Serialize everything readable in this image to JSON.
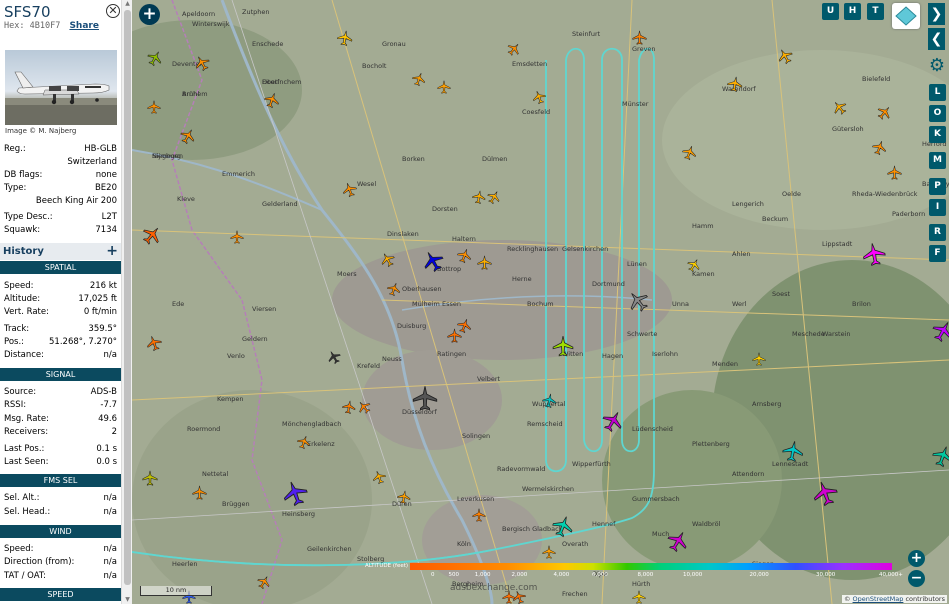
{
  "sidebar": {
    "callsign": "SFS70",
    "hex_label": "Hex:",
    "hex": "4B10F7",
    "share": "Share",
    "photo_credit": "Image © M. Najberg",
    "reg_label": "Reg.:",
    "reg": "HB-GLB",
    "country": "Switzerland",
    "dbflags_label": "DB flags:",
    "dbflags": "none",
    "type_label": "Type:",
    "type": "BE20",
    "type_name": "Beech King Air 200",
    "typedesc_label": "Type Desc.:",
    "typedesc": "L2T",
    "squawk_label": "Squawk:",
    "squawk": "7134",
    "history": "History",
    "spatial": "SPATIAL",
    "speed_label": "Speed:",
    "speed": "216 kt",
    "altitude_label": "Altitude:",
    "altitude": "17,025 ft",
    "vrate_label": "Vert. Rate:",
    "vrate": "0 ft/min",
    "track_label": "Track:",
    "track": "359.5°",
    "pos_label": "Pos.:",
    "pos": "51.268°, 7.270°",
    "distance_label": "Distance:",
    "distance": "n/a",
    "signal": "SIGNAL",
    "source_label": "Source:",
    "source": "ADS-B",
    "rssi_label": "RSSI:",
    "rssi": "-7.7",
    "msgrate_label": "Msg. Rate:",
    "msgrate": "49.6",
    "receivers_label": "Receivers:",
    "receivers": "2",
    "lastpos_label": "Last Pos.:",
    "lastpos": "0.1 s",
    "lastseen_label": "Last Seen:",
    "lastseen": "0.0 s",
    "fmssel": "FMS SEL",
    "selalt_label": "Sel. Alt.:",
    "selalt": "n/a",
    "selhead_label": "Sel. Head.:",
    "selhead": "n/a",
    "wind": "WIND",
    "wspeed_label": "Speed:",
    "wspeed": "n/a",
    "wdir_label": "Direction (from):",
    "wdir": "n/a",
    "tat_label": "TAT / OAT:",
    "tat": "n/a",
    "speed_section": "SPEED"
  },
  "map": {
    "buttons_top": [
      "U",
      "H",
      "T"
    ],
    "buttons_side": [
      "L",
      "O",
      "K",
      "M",
      "P",
      "I",
      "R",
      "F"
    ],
    "legend_title": "ALTITUDE (feet)",
    "legend_ticks": [
      "0",
      "500",
      "1,000",
      "2,000",
      "4,000",
      "6,000",
      "8,000",
      "10,000",
      "20,000",
      "30,000",
      "40,000+"
    ],
    "scale": "10 nm",
    "attribution_prefix": "©",
    "attribution_link": "OpenStreetMap",
    "attribution_suffix": "contributors",
    "watermark": "adsbexchange.com",
    "labels": [
      "Arnhem",
      "Nijmegen",
      "Doetinchem",
      "Bocholt",
      "Borken",
      "Coesfeld",
      "Dülmen",
      "Haltern",
      "Münster",
      "Warendorf",
      "Gütersloh",
      "Bielefeld",
      "Hamm",
      "Soest",
      "Unna",
      "Dortmund",
      "Bochum",
      "Herne",
      "Gelsenkirchen",
      "Recklinghausen",
      "Essen",
      "Bottrop",
      "Oberhausen",
      "Duisburg",
      "Mülheim",
      "Krefeld",
      "Venlo",
      "Düsseldorf",
      "Mönchengladbach",
      "Wuppertal",
      "Solingen",
      "Remscheid",
      "Hagen",
      "Iserlohn",
      "Arnsberg",
      "Lüdenscheid",
      "Leverkusen",
      "Köln",
      "Bergisch Gladbach",
      "Gummersbach",
      "Siegen",
      "Heerlen",
      "Roermond",
      "Moers",
      "Kleve",
      "Emmerich",
      "Wesel",
      "Dorsten",
      "Lippstadt",
      "Paderborn",
      "Olpe",
      "Meschede",
      "Erkelenz",
      "Dinslaken",
      "Lünen",
      "Schwerte",
      "Witten",
      "Velbert",
      "Ratingen",
      "Neuss",
      "Viersen",
      "Ahlen",
      "Beckum",
      "Kamen",
      "Werl",
      "Menden",
      "Plettenberg",
      "Wipperfürth",
      "Radevormwald",
      "Wermelskirchen",
      "Overath",
      "Hennef",
      "Much",
      "Waldbröl",
      "Attendorn",
      "Lennestadt",
      "Brilon",
      "Warstein",
      "Rheda-Wiedenbrück",
      "Oelde",
      "Herford",
      "Bad Oeynhausen",
      "Lengerich",
      "Emsdetten",
      "Greven",
      "Steinfurt",
      "Gronau",
      "Enschede",
      "Winterswijk",
      "Zutphen",
      "Deventer",
      "Apeldoorn",
      "Ede",
      "Gelderland",
      "Geldern",
      "Kempen",
      "Nettetal",
      "Brüggen",
      "Heinsberg",
      "Geilenkirchen",
      "Stolberg",
      "Düren",
      "Bergheim",
      "Frechen",
      "Hürth",
      "Brühl",
      "Siegburg",
      "Eitorf"
    ]
  }
}
